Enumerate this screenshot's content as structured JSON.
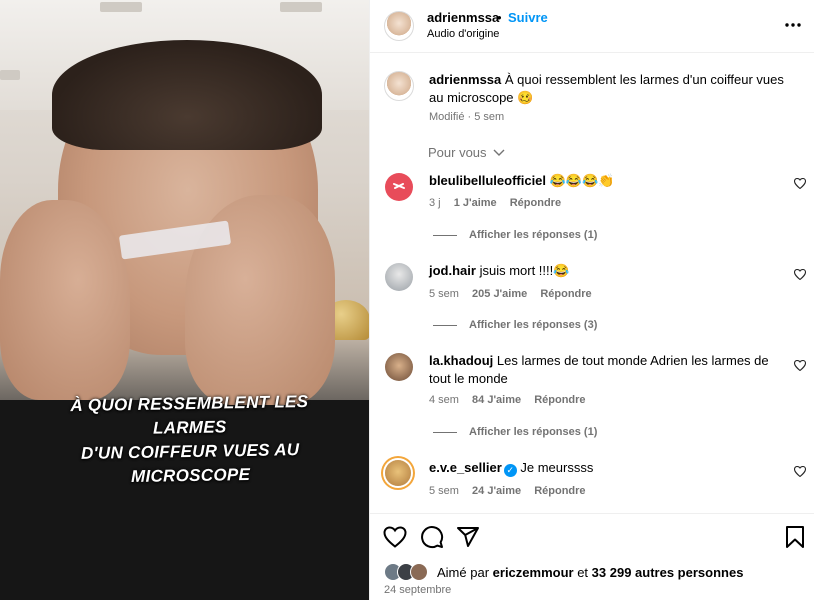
{
  "post": {
    "username": "adrienmssa",
    "dot": "•",
    "follow_label": "Suivre",
    "audio": "Audio d'origine",
    "more": "•••",
    "video_caption_line1": "À QUOI RESSEMBLENT LES LARMES",
    "video_caption_line2": "D'UN COIFFEUR VUES AU MICROSCOPE",
    "caption_username": "adrienmssa",
    "caption_text": "À quoi ressemblent les larmes d'un coiffeur vues au microscope 🥴",
    "caption_meta": "Modifié · 5 sem"
  },
  "for_you_label": "Pour vous",
  "comments": [
    {
      "username": "bleulibelluleofficiel",
      "text": "😂😂😂👏",
      "time": "3 j",
      "likes": "1 J'aime",
      "reply": "Répondre",
      "replies": "Afficher les réponses (1)"
    },
    {
      "username": "jod.hair",
      "text": "jsuis mort !!!!😂",
      "time": "5 sem",
      "likes": "205 J'aime",
      "reply": "Répondre",
      "replies": "Afficher les réponses (3)"
    },
    {
      "username": "la.khadouj",
      "text": "Les larmes de tout monde Adrien les larmes de tout le monde",
      "time": "4 sem",
      "likes": "84 J'aime",
      "reply": "Répondre",
      "replies": "Afficher les réponses (1)"
    },
    {
      "username": "e.v.e_sellier",
      "text": "Je meurssss",
      "time": "5 sem",
      "likes": "24 J'aime",
      "reply": "Répondre"
    }
  ],
  "footer": {
    "liked_prefix": "Aimé par",
    "liked_user": "ericzemmour",
    "liked_and": "et",
    "liked_count": "33 299 autres personnes",
    "date": "24 septembre"
  },
  "icons": [
    "heart-icon",
    "comment-icon",
    "share-icon",
    "bookmark-icon",
    "more-icon",
    "chevron-down-icon",
    "verified-icon"
  ]
}
